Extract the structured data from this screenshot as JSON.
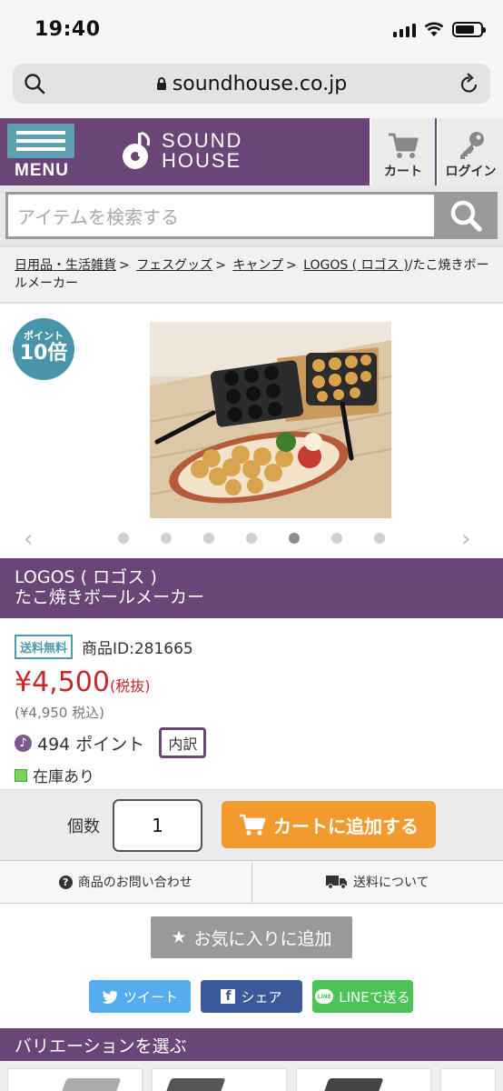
{
  "status_bar": {
    "time": "19:40"
  },
  "browser": {
    "url": "soundhouse.co.jp"
  },
  "header": {
    "menu_label": "MENU",
    "logo_line1": "SOUND",
    "logo_line2": "HOUSE",
    "cart_label": "カート",
    "login_label": "ログイン"
  },
  "search": {
    "placeholder": "アイテムを検索する"
  },
  "breadcrumb": {
    "items": [
      "日用品・生活雑貨",
      "フェスグッズ",
      "キャンプ",
      "LOGOS ( ロゴス )"
    ],
    "current": "/たこ焼きボールメーカー",
    "separator": ">"
  },
  "gallery": {
    "badge_top": "ポイント",
    "badge_value": "10倍",
    "image_count": 7,
    "active_index": 4
  },
  "product": {
    "brand": "LOGOS ( ロゴス )",
    "name": "たこ焼きボールメーカー",
    "free_shipping": "送料無料",
    "product_id": "商品ID:281665",
    "price": "¥4,500",
    "price_note": "(税抜)",
    "price_tax_in": "(¥4,950 税込)",
    "points": "494 ポイント",
    "breakdown_label": "内訳",
    "stock": "在庫あり"
  },
  "cart": {
    "qty_label": "個数",
    "qty_value": "1",
    "add_label": "カートに追加する"
  },
  "links": {
    "contact": "商品のお問い合わせ",
    "shipping": "送料について"
  },
  "favorite": {
    "label": "お気に入りに追加"
  },
  "share": {
    "tweet": "ツイート",
    "facebook": "シェア",
    "line": "LINEで送る"
  },
  "variation": {
    "title": "バリエーションを選ぶ"
  },
  "colors": {
    "purple": "#6a4577",
    "teal": "#4894a8",
    "price_red": "#c8272a",
    "orange": "#f29a2e"
  }
}
